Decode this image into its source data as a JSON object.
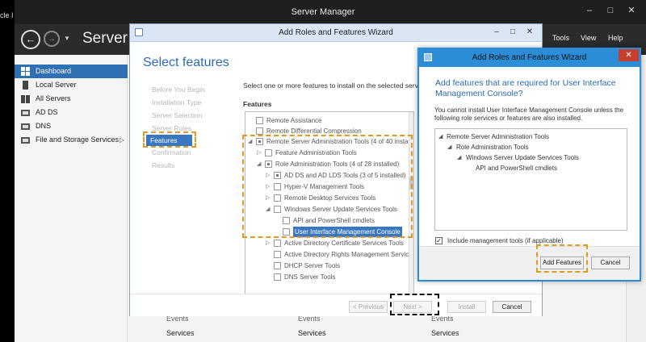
{
  "server_manager": {
    "title": "Server Manager",
    "left_clip": "cle I",
    "header_title": "Server M",
    "menu": [
      "Tools",
      "View",
      "Help"
    ],
    "nav": [
      "Dashboard",
      "Local Server",
      "All Servers",
      "AD DS",
      "DNS",
      "File and Storage Services"
    ],
    "bottom_tile_row1": [
      "Events",
      "Events",
      "Events"
    ],
    "bottom_services": [
      "Services",
      "Services",
      "Services"
    ]
  },
  "wizard": {
    "title": "Add Roles and Features Wizard",
    "heading": "Select features",
    "steps": [
      "Before You Begin",
      "Installation Type",
      "Server Selection",
      "Server Roles",
      "Features",
      "Confirmation",
      "Results"
    ],
    "active_step_index": 4,
    "description": "Select one or more features to install on the selected server.",
    "features_label": "Features",
    "tree": [
      {
        "label": "Remote Assistance",
        "checkbox": "unchecked"
      },
      {
        "label": "Remote Differential Compression",
        "checkbox": "unchecked"
      },
      {
        "label": "Remote Server Administration Tools (4 of 40 install",
        "checkbox": "partial",
        "expanded": true
      },
      {
        "label": "Feature Administration Tools",
        "checkbox": "unchecked",
        "expanded": false
      },
      {
        "label": "Role Administration Tools (4 of 28 installed)",
        "checkbox": "partial",
        "expanded": true
      },
      {
        "label": "AD DS and AD LDS Tools (3 of 5 installed)",
        "checkbox": "partial",
        "expanded": false
      },
      {
        "label": "Hyper-V Management Tools",
        "checkbox": "unchecked",
        "expanded": false
      },
      {
        "label": "Remote Desktop Services Tools",
        "checkbox": "unchecked",
        "expanded": false
      },
      {
        "label": "Windows Server Update Services Tools",
        "checkbox": "unchecked",
        "expanded": true
      },
      {
        "label": "API and PowerShell cmdlets",
        "checkbox": "unchecked"
      },
      {
        "label": "User Interface Management Console",
        "checkbox": "unchecked",
        "selected": true
      },
      {
        "label": "Active Directory Certificate Services Tools",
        "checkbox": "unchecked",
        "expanded": false
      },
      {
        "label": "Active Directory Rights Management Servic",
        "checkbox": "unchecked"
      },
      {
        "label": "DHCP Server Tools",
        "checkbox": "unchecked"
      },
      {
        "label": "DNS Server Tools",
        "checkbox": "unchecked"
      }
    ],
    "buttons": {
      "previous": "< Previous",
      "next": "Next >",
      "install": "Install",
      "cancel": "Cancel"
    }
  },
  "dialog": {
    "title": "Add Roles and Features Wizard",
    "question": "Add features that are required for User Interface Management Console?",
    "info": "You cannot install User Interface Management Console unless the following role services or features are also installed.",
    "list": [
      "Remote Server Administration Tools",
      "Role Administration Tools",
      "Windows Server Update Services Tools",
      "API and PowerShell cmdlets"
    ],
    "include_label": "Include management tools (if applicable)",
    "include_checked": true,
    "buttons": {
      "add": "Add Features",
      "cancel": "Cancel"
    }
  },
  "colors": {
    "accent": "#2b8dd8",
    "highlight_dash": "#e39a21",
    "nav_active": "#2f6fb3"
  }
}
